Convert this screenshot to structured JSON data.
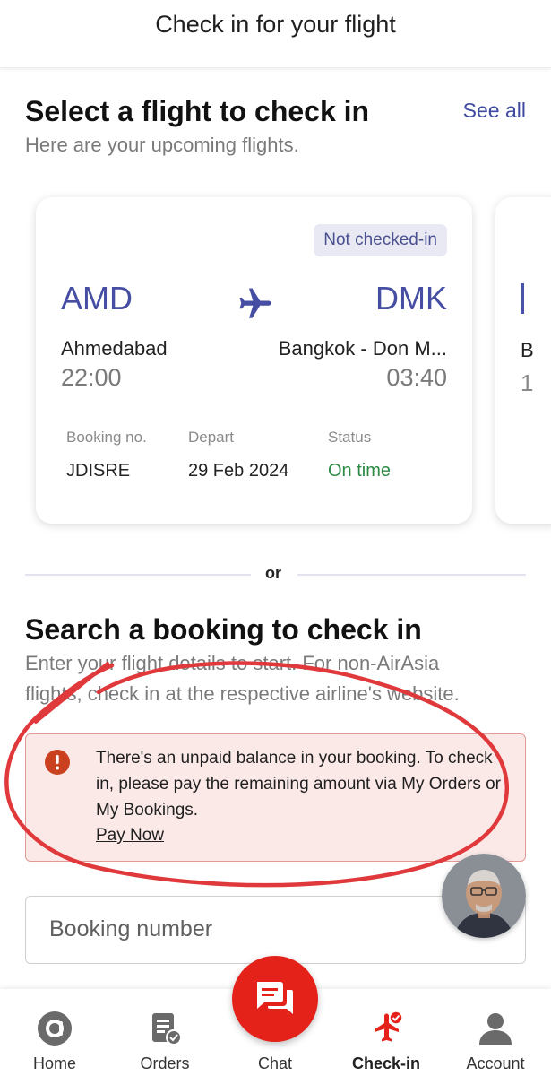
{
  "header": {
    "title": "Check in for your flight"
  },
  "upcoming": {
    "title": "Select a flight to check in",
    "subtitle": "Here are your upcoming flights.",
    "see_all": "See all"
  },
  "flight_card": {
    "status_badge": "Not checked-in",
    "from_code": "AMD",
    "to_code": "DMK",
    "from_city": "Ahmedabad",
    "to_city": "Bangkok - Don M...",
    "depart_time": "22:00",
    "arrive_time": "03:40",
    "booking_label": "Booking no.",
    "booking_value": "JDISRE",
    "depart_label": "Depart",
    "depart_value": "29 Feb 2024",
    "status_label": "Status",
    "status_value": "On time",
    "status_color": "#2c8a45",
    "code_color": "#464ea3"
  },
  "next_card_peek": {
    "city_initial": "B",
    "time_initial": "1"
  },
  "divider": {
    "label": "or"
  },
  "search": {
    "title": "Search a booking to check in",
    "subtitle_line1": "Enter your flight details to start. For non-AirAsia",
    "subtitle_line2": "flights, check in at the respective airline's website."
  },
  "alert": {
    "message": "There's an unpaid balance in your booking. To check in, please pay the remaining amount via My Orders or My Bookings.",
    "link": "Pay Now",
    "icon": "exclamation-icon"
  },
  "booking_input": {
    "placeholder": "Booking number"
  },
  "bottom_nav": {
    "home": "Home",
    "orders": "Orders",
    "chat": "Chat",
    "checkin": "Check-in",
    "account": "Account",
    "accent": "#e4221a"
  }
}
